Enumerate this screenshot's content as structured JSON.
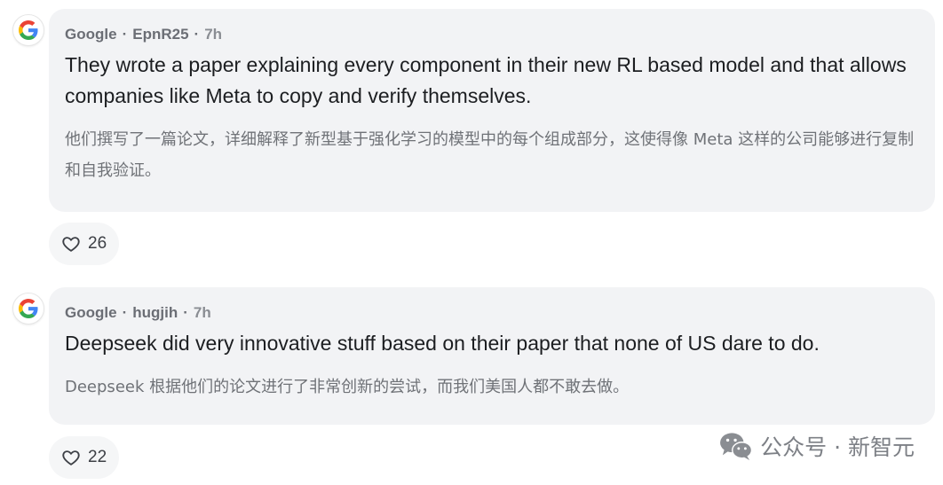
{
  "comments": [
    {
      "source": "Google",
      "separator": "·",
      "username": "EpnR25",
      "time": "7h",
      "text": "They wrote a paper explaining every component in their new RL based model and that allows companies like Meta to copy and verify themselves.",
      "translation": "他们撰写了一篇论文，详细解释了新型基于强化学习的模型中的每个组成部分，这使得像 Meta 这样的公司能够进行复制和自我验证。",
      "likes": "26",
      "avatar_icon": "google-logo-icon"
    },
    {
      "source": "Google",
      "separator": "·",
      "username": "hugjih",
      "time": "7h",
      "text": "Deepseek did very innovative stuff based on their paper that none of US dare to do.",
      "translation": "Deepseek 根据他们的论文进行了非常创新的尝试，而我们美国人都不敢去做。",
      "likes": "22",
      "avatar_icon": "google-logo-icon"
    }
  ],
  "watermark": {
    "text": "公众号 · 新智元",
    "icon": "wechat-icon"
  },
  "colors": {
    "bubble_bg": "#f2f3f5",
    "main_text": "#1c1e21",
    "meta_text": "#6b6e75",
    "translation_text": "#6f7277"
  }
}
